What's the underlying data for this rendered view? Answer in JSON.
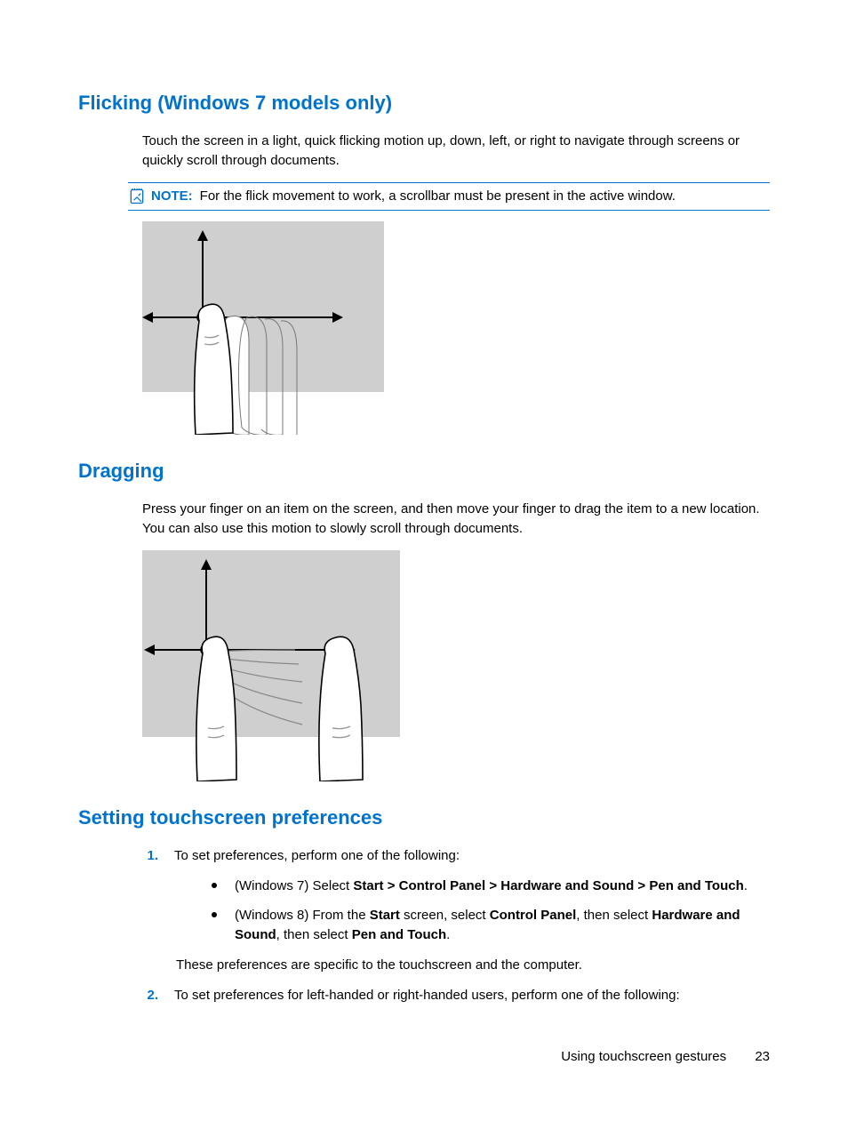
{
  "section1": {
    "heading": "Flicking (Windows 7 models only)",
    "para": "Touch the screen in a light, quick flicking motion up, down, left, or right to navigate through screens or quickly scroll through documents.",
    "note_label": "NOTE:",
    "note_text": "For the flick movement to work, a scrollbar must be present in the active window."
  },
  "section2": {
    "heading": "Dragging",
    "para": "Press your finger on an item on the screen, and then move your finger to drag the item to a new location. You can also use this motion to slowly scroll through documents."
  },
  "section3": {
    "heading": "Setting touchscreen preferences",
    "step1_num": "1.",
    "step1_text": "To set preferences, perform one of the following:",
    "bullet1_pre": "(Windows 7) Select ",
    "bullet1_bold": "Start > Control Panel > Hardware and Sound > Pen and Touch",
    "bullet1_post": ".",
    "bullet2_pre": "(Windows 8) From the ",
    "bullet2_b1": "Start",
    "bullet2_mid1": " screen, select ",
    "bullet2_b2": "Control Panel",
    "bullet2_mid2": ", then select ",
    "bullet2_b3": "Hardware and Sound",
    "bullet2_mid3": ", then select ",
    "bullet2_b4": "Pen and Touch",
    "bullet2_post": ".",
    "step1_after": "These preferences are specific to the touchscreen and the computer.",
    "step2_num": "2.",
    "step2_text": "To set preferences for left-handed or right-handed users, perform one of the following:"
  },
  "footer": {
    "section": "Using touchscreen gestures",
    "page": "23"
  }
}
